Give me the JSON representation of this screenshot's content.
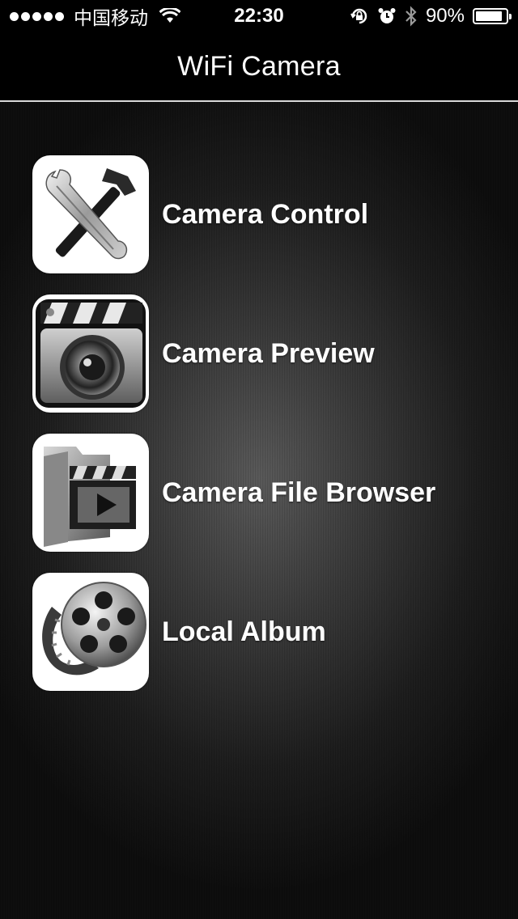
{
  "status_bar": {
    "carrier": "中国移动",
    "time": "22:30",
    "battery_percent": "90%",
    "battery_level": 0.9,
    "icons": [
      "signal-dots-icon",
      "wifi-icon",
      "orientation-lock-icon",
      "alarm-icon",
      "bluetooth-icon",
      "battery-icon"
    ]
  },
  "nav": {
    "title": "WiFi Camera"
  },
  "menu": {
    "items": [
      {
        "label": "Camera Control",
        "icon": "wrench-hammer-icon"
      },
      {
        "label": "Camera Preview",
        "icon": "clapper-lens-icon"
      },
      {
        "label": "Camera File Browser",
        "icon": "folder-video-icon"
      },
      {
        "label": "Local Album",
        "icon": "film-reel-icon"
      }
    ]
  },
  "colors": {
    "background": "#000000",
    "divider": "#d9d9d9",
    "text": "#ffffff"
  }
}
